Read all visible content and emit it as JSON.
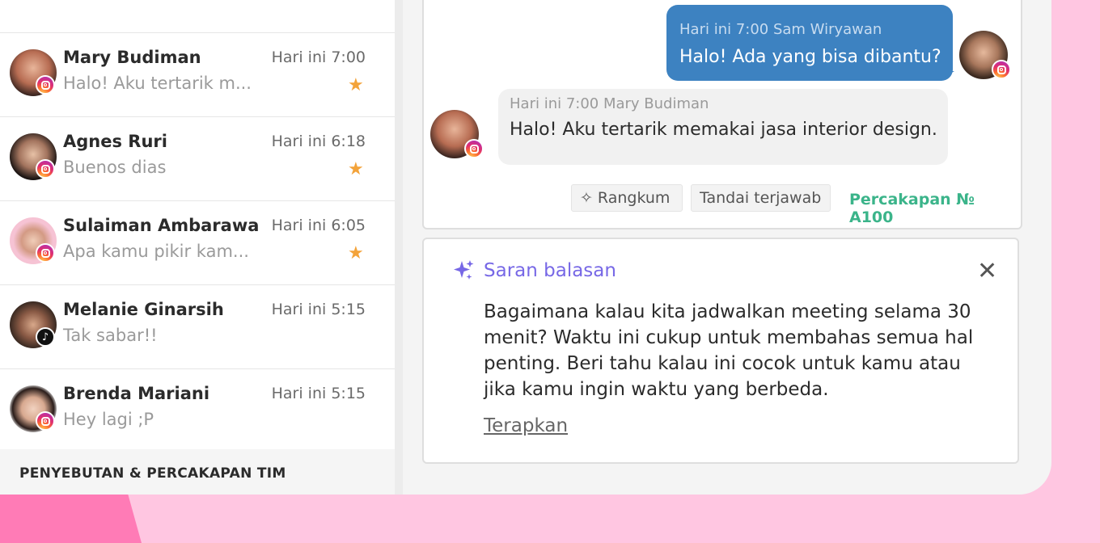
{
  "conversations": [
    {
      "name": "Mary Budiman",
      "time": "Hari ini 7:00",
      "preview": "Halo! Aku tertarik m...",
      "starred": true,
      "channel": "instagram"
    },
    {
      "name": "Agnes Ruri",
      "time": "Hari ini 6:18",
      "preview": "Buenos dias",
      "starred": true,
      "channel": "instagram"
    },
    {
      "name": "Sulaiman Ambarawa",
      "time": "Hari ini 6:05",
      "preview": "Apa kamu pikir kam...",
      "starred": true,
      "channel": "instagram"
    },
    {
      "name": "Melanie Ginarsih",
      "time": "Hari ini 5:15",
      "preview": "Tak sabar!!",
      "starred": false,
      "channel": "tiktok"
    },
    {
      "name": "Brenda Mariani",
      "time": "Hari ini 5:15",
      "preview": "Hey lagi ;P",
      "starred": false,
      "channel": "instagram"
    }
  ],
  "section_heading": "PENYEBUTAN & PERCAKAPAN TIM",
  "chat": {
    "outgoing": {
      "meta": "Hari ini 7:00 Sam Wiryawan",
      "text": "Halo! Ada yang bisa dibantu?"
    },
    "incoming": {
      "meta": "Hari ini 7:00 Mary Budiman",
      "text": "Halo! Aku tertarik memakai jasa interior design."
    },
    "summarize_label": "Rangkum",
    "mark_answered_label": "Tandai terjawab",
    "conversation_id": "Percakapan № A100"
  },
  "suggestion": {
    "title": "Saran balasan",
    "body": "Bagaimana kalau kita jadwalkan meeting selama 30 menit? Waktu ini cukup untuk membahas semua hal penting. Beri tahu kalau ini cocok untuk kamu atau jika kamu ingin waktu yang berbeda.",
    "apply_label": "Terapkan"
  },
  "colors": {
    "accent": "#3d82c1",
    "ai": "#7768e6",
    "success": "#3bb48a",
    "star": "#f3a33a",
    "page_bg": "#ffc6e1"
  }
}
